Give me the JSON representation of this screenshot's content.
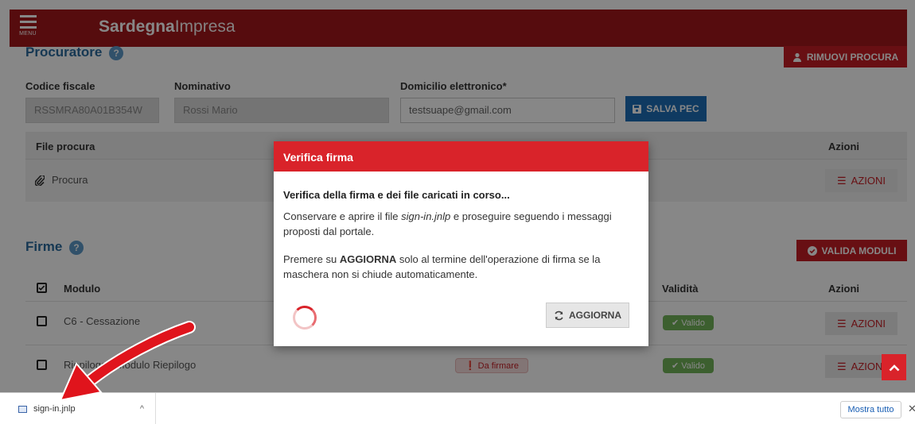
{
  "header": {
    "menu_label": "MENU",
    "brand_bold": "Sardegna",
    "brand_light": "Impresa"
  },
  "procuratore": {
    "title": "Procuratore",
    "help_glyph": "?",
    "remove_button": "RIMUOVI PROCURA",
    "fields": {
      "codice_fiscale_label": "Codice fiscale",
      "codice_fiscale_value": "RSSMRA80A01B354W",
      "nominativo_label": "Nominativo",
      "nominativo_value": "Rossi Mario",
      "domicilio_label": "Domicilio elettronico*",
      "domicilio_value": "testsuape@gmail.com",
      "save_pec_button": "SALVA PEC"
    },
    "file_table": {
      "col_file": "File procura",
      "col_actions": "Azioni",
      "row_file": "Procura",
      "row_action": "AZIONI"
    }
  },
  "firme": {
    "title": "Firme",
    "help_glyph": "?",
    "validate_button": "VALIDA MODULI",
    "columns": {
      "module": "Modulo",
      "validity": "Validità",
      "actions": "Azioni"
    },
    "rows": [
      {
        "module": "C6 - Cessazione",
        "status": "",
        "validity": "Valido",
        "action": "AZIONI"
      },
      {
        "module": "Riepilogo - Modulo Riepilogo",
        "status": "Da firmare",
        "validity": "Valido",
        "action": "AZIONI"
      }
    ]
  },
  "modal": {
    "title": "Verifica firma",
    "heading": "Verifica della firma e dei file caricati in corso...",
    "p1_a": "Conservare e aprire il file ",
    "p1_file": "sign-in.jnlp",
    "p1_b": " e proseguire seguendo i messaggi proposti dal portale.",
    "p2_a": "Premere su ",
    "p2_bold": "AGGIORNA",
    "p2_b": " solo al termine dell'operazione di firma se la maschera non si chiude automaticamente.",
    "refresh_button": "AGGIORNA"
  },
  "download_bar": {
    "file_name": "sign-in.jnlp",
    "show_all": "Mostra tutto",
    "close_glyph": "✕",
    "chevron_glyph": "^"
  },
  "colors": {
    "brand_red": "#a3181b",
    "accent_red": "#d9232a",
    "blue": "#1d6fb8",
    "valid_green": "#72b35a"
  }
}
